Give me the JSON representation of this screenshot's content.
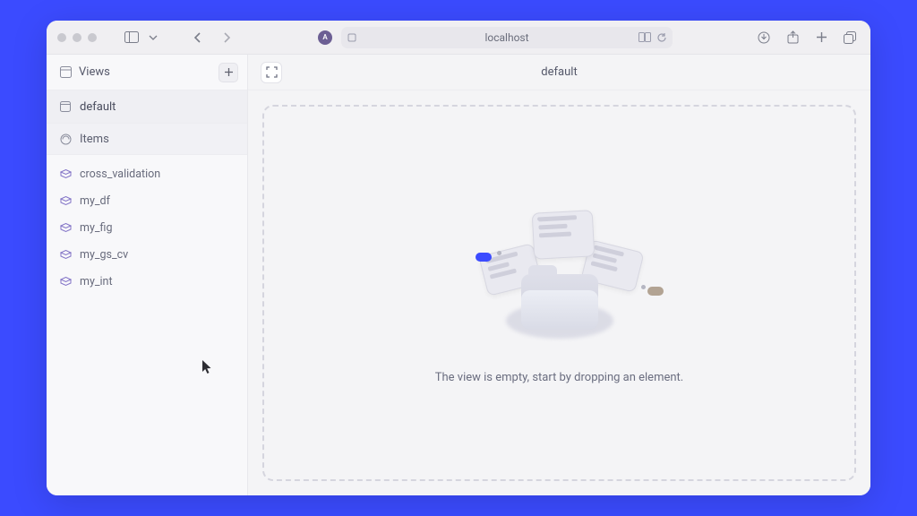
{
  "browser": {
    "address": "localhost",
    "badge": "A"
  },
  "sidebar": {
    "title": "Views",
    "views": [
      {
        "label": "default"
      }
    ],
    "items_header": "Items",
    "items": [
      {
        "label": "cross_validation"
      },
      {
        "label": "my_df"
      },
      {
        "label": "my_fig"
      },
      {
        "label": "my_gs_cv"
      },
      {
        "label": "my_int"
      }
    ]
  },
  "main": {
    "title": "default",
    "empty_text": "The view is empty, start by dropping an element."
  }
}
